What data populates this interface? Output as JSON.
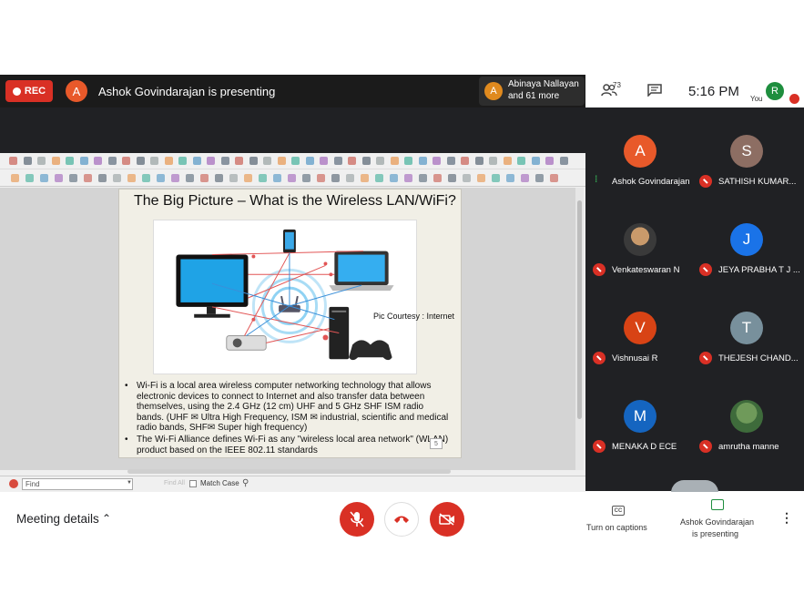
{
  "topbar": {
    "rec_label": "REC",
    "presenter_initial": "A",
    "presenting_text": "Ashok Govindarajan is presenting",
    "others_initial": "A",
    "others_name": "Abinaya Nallayan",
    "others_more": "and 61 more"
  },
  "header": {
    "people_count": "73",
    "clock": "5:16 PM",
    "you_label": "You",
    "self_initial": "R"
  },
  "slide": {
    "title": "The Big Picture – What is the Wireless LAN/WiFi?",
    "courtesy": "Pic Courtesy : Internet",
    "bullet1": "Wi-Fi  is a local area wireless computer networking technology that allows electronic devices to connect to Internet and also transfer data between themselves, using the 2.4 GHz (12 cm) UHF and 5 GHz SHF ISM radio bands. (UHF ✉ Ultra High Frequency, ISM  ✉ industrial, scientific and medical radio bands, SHF✉ Super high frequency)",
    "bullet2": "The Wi-Fi Alliance defines Wi-Fi as any \"wireless local area network\" (WLAN) product based on the IEEE 802.11 standards",
    "page_number": "5"
  },
  "findbar": {
    "placeholder": "Find",
    "find_all": "Find All",
    "match_case": "Match Case"
  },
  "participants": [
    {
      "initial": "A",
      "name": "Ashok Govindarajan",
      "color": "#e8592a"
    },
    {
      "initial": "S",
      "name": "SATHISH KUMAR...",
      "color": "#8d6e63"
    },
    {
      "initial": "",
      "name": "Venkateswaran N",
      "color": "#5d4037"
    },
    {
      "initial": "J",
      "name": "JEYA PRABHA T J ...",
      "color": "#1a73e8"
    },
    {
      "initial": "V",
      "name": "Vishnusai R",
      "color": "#d84315"
    },
    {
      "initial": "T",
      "name": "THEJESH CHAND...",
      "color": "#78909c"
    },
    {
      "initial": "M",
      "name": "MENAKA D ECE",
      "color": "#1565c0"
    },
    {
      "initial": "",
      "name": "amrutha manne",
      "color": "#4e7d46"
    }
  ],
  "bottombar": {
    "meeting_details": "Meeting details",
    "captions_label": "Turn on captions",
    "cc_glyph": "CC",
    "presenting_line1": "Ashok Govindarajan",
    "presenting_line2": "is presenting"
  },
  "colors": {
    "danger": "#d93025",
    "talk": "#34a853",
    "panel": "#202124"
  }
}
